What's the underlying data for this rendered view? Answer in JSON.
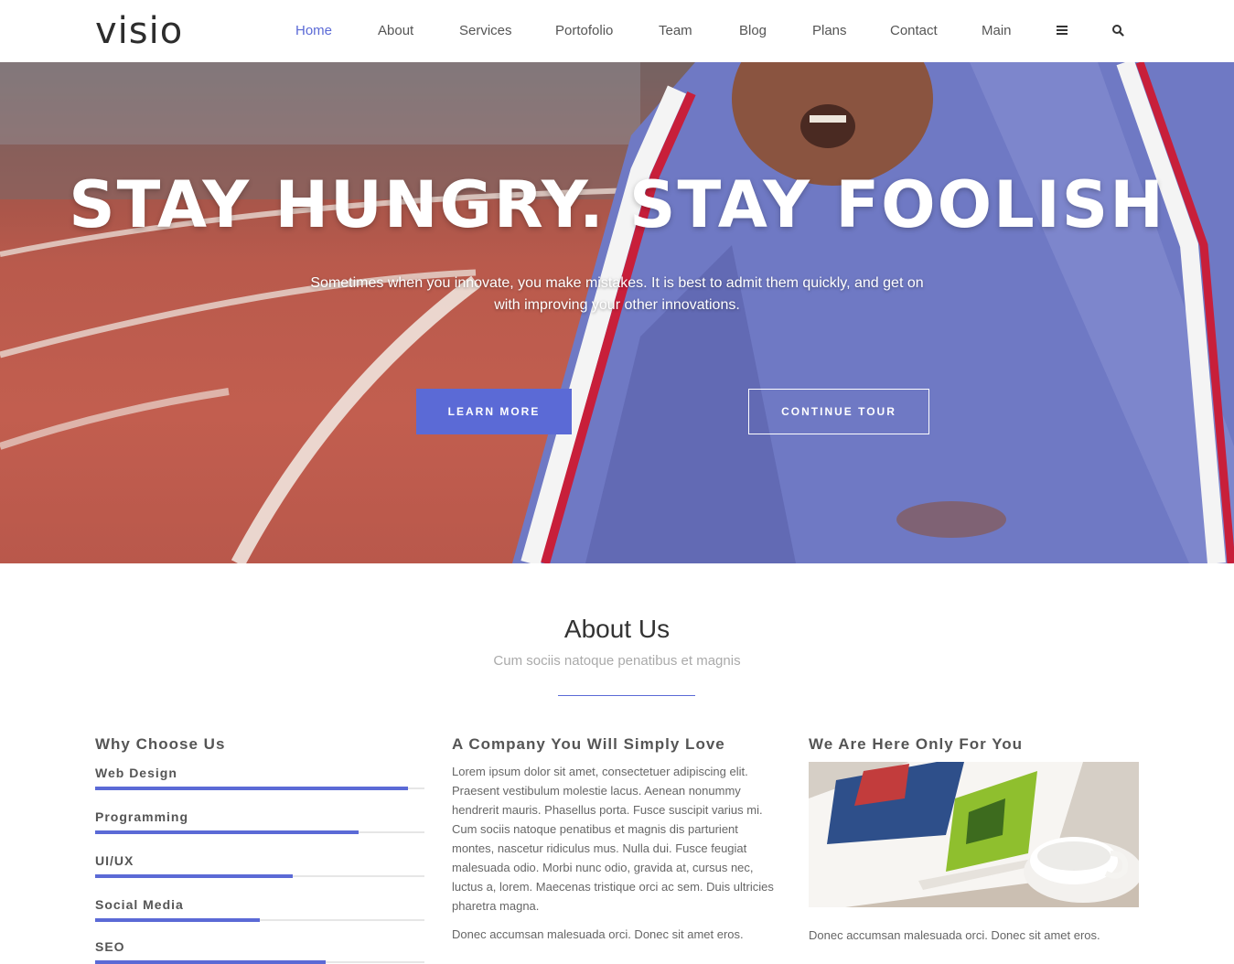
{
  "nav": {
    "logo": "visio",
    "items": [
      {
        "label": "Home",
        "active": true
      },
      {
        "label": "About"
      },
      {
        "label": "Services"
      },
      {
        "label": "Portofolio"
      },
      {
        "label": "Team"
      },
      {
        "label": "Blog"
      },
      {
        "label": "Plans"
      },
      {
        "label": "Contact"
      },
      {
        "label": "Main"
      }
    ],
    "icons": [
      "hamburger-icon",
      "search-icon"
    ]
  },
  "hero": {
    "title": "STAY HUNGRY. STAY FOOLISH",
    "subtitle": "Sometimes when you innovate, you make mistakes. It is best to admit them quickly, and get on with improving your other innovations.",
    "primary_button": "LEARN MORE",
    "secondary_button": "CONTINUE TOUR"
  },
  "about": {
    "title": "About Us",
    "subtitle": "Cum sociis natoque penatibus et magnis",
    "why": {
      "title": "Why Choose Us",
      "skills": [
        {
          "label": "Web Design",
          "percent": 95
        },
        {
          "label": "Programming",
          "percent": 80
        },
        {
          "label": "UI/UX",
          "percent": 60
        },
        {
          "label": "Social Media",
          "percent": 50
        },
        {
          "label": "SEO",
          "percent": 70
        }
      ]
    },
    "company": {
      "title": "A Company You Will Simply Love",
      "text": "Lorem ipsum dolor sit amet, consectetuer adipiscing elit. Praesent vestibulum molestie lacus. Aenean nonummy hendrerit mauris. Phasellus porta. Fusce suscipit varius mi. Cum sociis natoque penatibus et magnis dis parturient montes, nascetur ridiculus mus. Nulla dui. Fusce feugiat malesuada odio. Morbi nunc odio, gravida at, cursus nec, luctus a, lorem. Maecenas tristique orci ac sem. Duis ultricies pharetra magna.",
      "text2": "Donec accumsan malesuada orci. Donec sit amet eros."
    },
    "here": {
      "title": "We Are Here Only For You",
      "text": "Donec accumsan malesuada orci. Donec sit amet eros."
    }
  },
  "colors": {
    "accent": "#5b6ad6"
  }
}
